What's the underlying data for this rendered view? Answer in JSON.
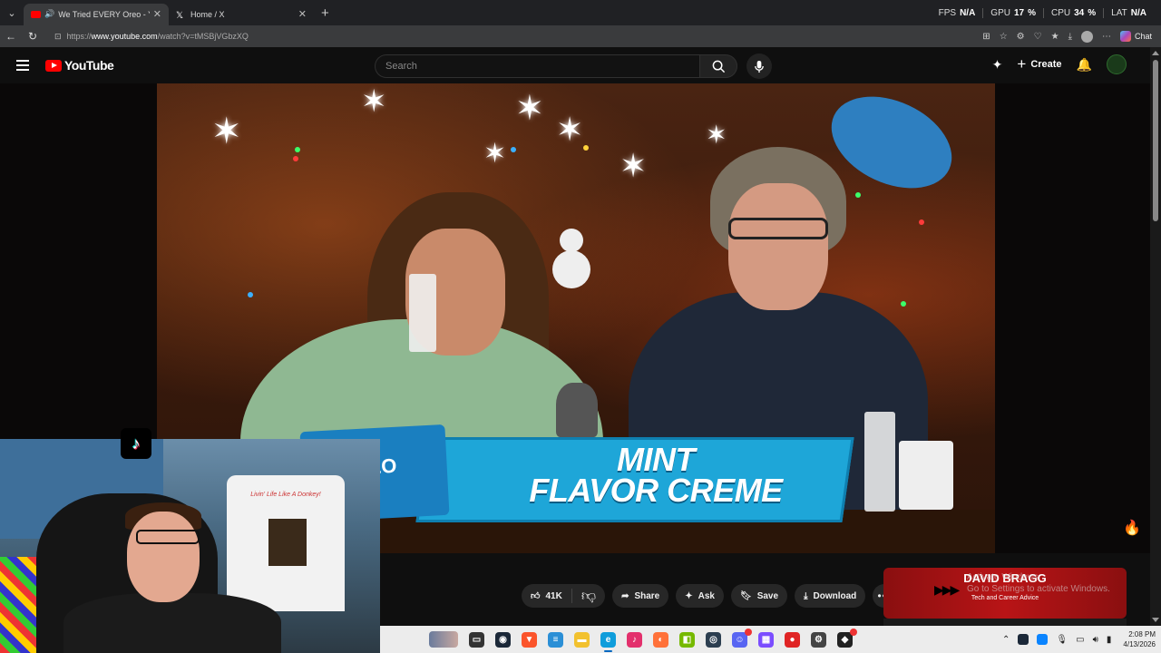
{
  "browser": {
    "tabs": [
      {
        "title": "We Tried EVERY Oreo - YouTube",
        "active": true
      },
      {
        "title": "Home / X",
        "active": false
      }
    ],
    "url_scheme": "https://",
    "url_host": "www.youtube.com",
    "url_path": "/watch?v=tMSBjVGbzXQ",
    "chat_label": "Chat",
    "perf": {
      "fps_label": "FPS",
      "fps_value": "N/A",
      "gpu_label": "GPU",
      "gpu_value": "17",
      "cpu_label": "CPU",
      "cpu_value": "34",
      "lat_label": "LAT",
      "lat_value": "N/A",
      "percent": "%"
    }
  },
  "youtube": {
    "logo_text": "YouTube",
    "search_placeholder": "Search",
    "create_label": "Create"
  },
  "video": {
    "overlay_line1": "MINT",
    "overlay_line2": "FLAVOR CREME",
    "pack_text": "OREO",
    "shirt_text": "Livin' Life Like A Donkey!"
  },
  "actions": {
    "like_count": "41K",
    "share_label": "Share",
    "ask_label": "Ask",
    "save_label": "Save",
    "download_label": "Download"
  },
  "ad": {
    "name": "DAVID BRAGG",
    "subtitle": "Tech and Career Advice"
  },
  "watermark": {
    "line1": "Activate Windows",
    "line2": "Go to Settings to activate Windows."
  },
  "taskbar": {
    "time": "2:08 PM",
    "date": "4/13/2026"
  },
  "colors": {
    "youtube_red": "#ff0000",
    "banner_blue": "#1ea6d8",
    "ad_red": "#b81416"
  }
}
